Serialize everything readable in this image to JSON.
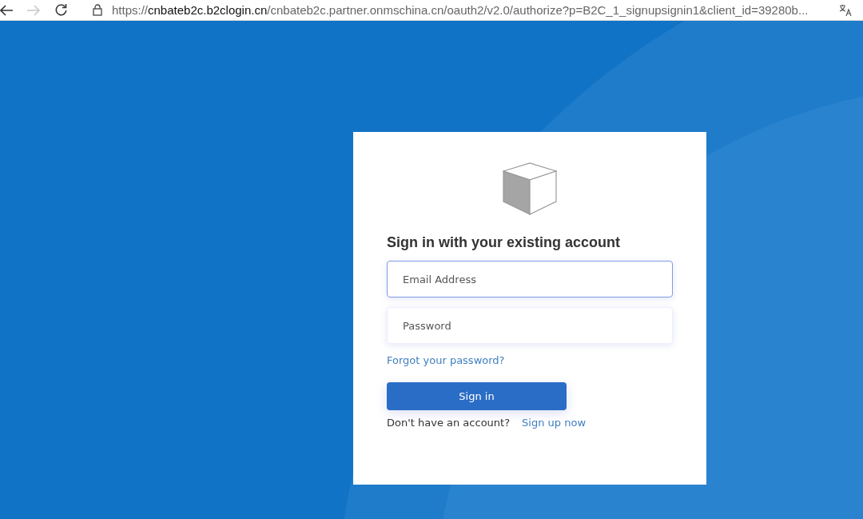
{
  "browser": {
    "nav": [
      {
        "kind": "back",
        "disabled": false
      },
      {
        "kind": "forward",
        "disabled": true
      },
      {
        "kind": "reload",
        "disabled": false
      }
    ],
    "url": "https://**cnbateb2c.b2clogin.cn**/cnbateb2c.partner.onmschina.cn/oauth2/v2.0/authorize?p=B2C_1_signupsignin1&client_id=39280b..."
  },
  "card": {
    "heading": "Sign in with your existing account",
    "fields": [
      {
        "placeholder": "Email Address",
        "focused": true
      },
      {
        "placeholder": "Password",
        "focused": false
      }
    ],
    "forgot_link": "Forgot your password?",
    "button": "Sign in",
    "signup_prompt": "Don't have an account?",
    "signup_link": "Sign up now"
  }
}
